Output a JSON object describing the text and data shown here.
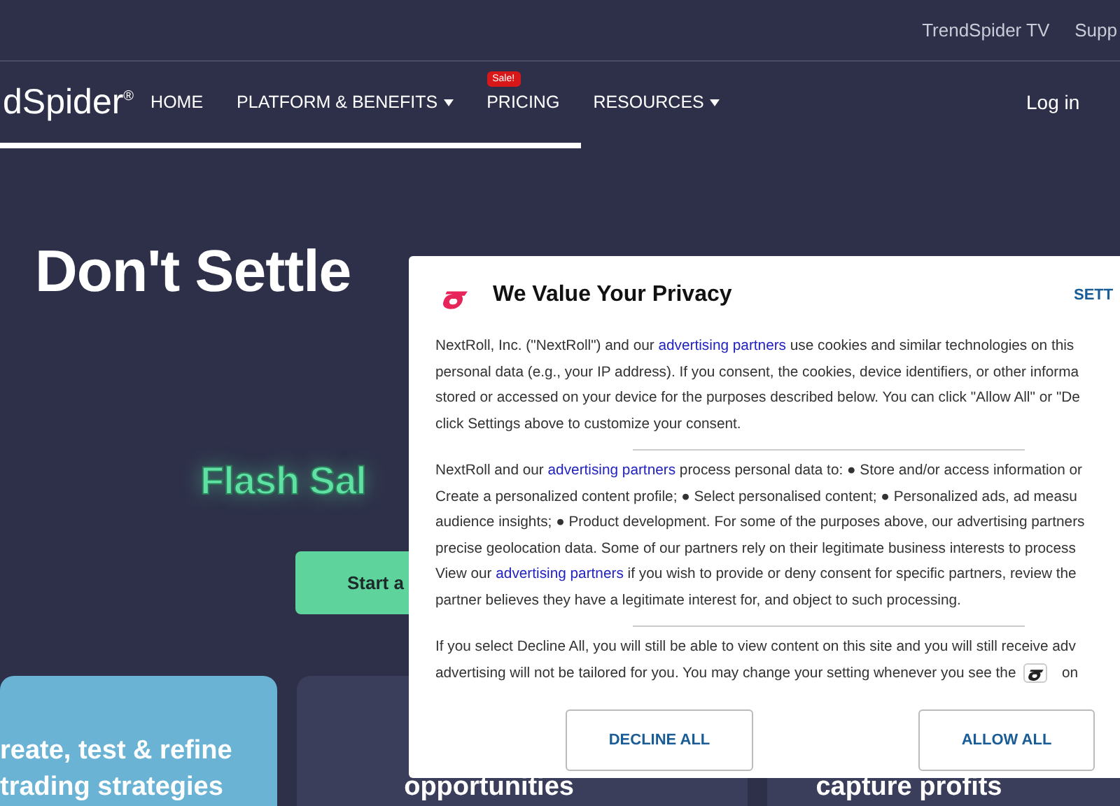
{
  "top_bar": {
    "links": [
      "TrendSpider TV",
      "Supp"
    ]
  },
  "nav": {
    "logo": "dSpider",
    "logo_mark": "®",
    "items": [
      {
        "label": "HOME",
        "dropdown": false
      },
      {
        "label": "PLATFORM & BENEFITS",
        "dropdown": true
      },
      {
        "label": "PRICING",
        "dropdown": false,
        "badge": "Sale!"
      },
      {
        "label": "RESOURCES",
        "dropdown": true
      }
    ],
    "login": "Log in"
  },
  "hero": {
    "title": "Don't Settle",
    "sale": "Flash Sal",
    "cta": "Start a"
  },
  "cards": [
    {
      "lines": [
        "reate, test & refine",
        "trading strategies"
      ],
      "highlight": true
    },
    {
      "lines": [
        "opportunities"
      ],
      "highlight": false
    },
    {
      "lines": [
        "capture profits"
      ],
      "highlight": false
    }
  ],
  "consent": {
    "title": "We Value Your Privacy",
    "settings": "SETT",
    "paragraphs": [
      [
        [
          "NextRoll, Inc. (\"NextRoll\") and our ",
          {
            "link": "advertising partners"
          },
          " use cookies and similar technologies on this"
        ],
        [
          "personal data (e.g., your IP address). If you consent, the cookies, device identifiers, or other informa"
        ],
        [
          "stored or accessed on your device for the purposes described below. You can click \"Allow All\" or \"De"
        ],
        [
          "click Settings above to customize your consent."
        ]
      ],
      [
        [
          "NextRoll and our ",
          {
            "link": "advertising partners"
          },
          " process personal data to: ● Store and/or access information or"
        ],
        [
          "Create a personalized content profile; ● Select personalised content; ● Personalized ads, ad measu"
        ],
        [
          "audience insights; ● Product development. For some of the purposes above, our advertising partners"
        ],
        [
          "precise geolocation data. Some of our partners rely on their legitimate business interests to process"
        ],
        [
          "View our ",
          {
            "link": "advertising partners"
          },
          " if you wish to provide or deny consent for specific partners, review the"
        ],
        [
          "partner believes they have a legitimate interest for, and object to such processing."
        ]
      ],
      [
        [
          "If you select Decline All, you will still be able to view content on this site and you will still receive adv"
        ],
        [
          "advertising will not be tailored for you. You may change your setting whenever you see the ",
          {
            "kind": "icon"
          },
          " on"
        ]
      ]
    ],
    "buttons": [
      "DECLINE ALL",
      "ALLOW ALL"
    ]
  }
}
